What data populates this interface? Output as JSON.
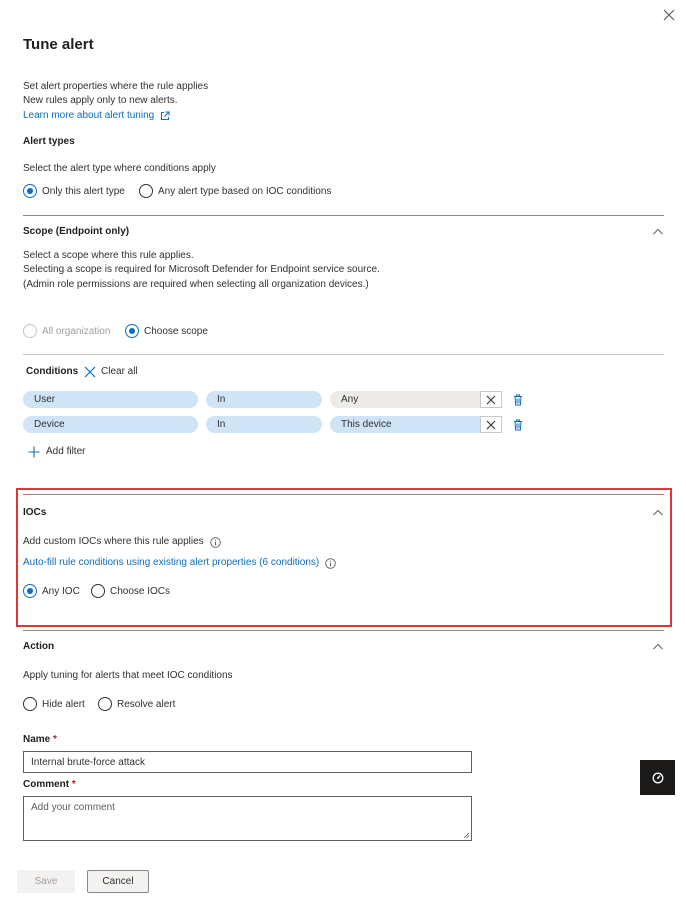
{
  "panel": {
    "title": "Tune alert",
    "intro_line1": "Set alert properties where the rule applies",
    "intro_line2": "New rules apply only to new alerts.",
    "learn_more": "Learn more about alert tuning"
  },
  "alert_types": {
    "heading": "Alert types",
    "description": "Select the alert type where conditions apply",
    "options": [
      "Only this alert type",
      "Any alert type based on IOC conditions"
    ],
    "selected": 0
  },
  "scope": {
    "heading": "Scope (Endpoint only)",
    "line1": "Select a scope where this rule applies.",
    "line2": "Selecting a scope is required for Microsoft Defender for Endpoint service source.",
    "line3": "(Admin role permissions are required when selecting all organization devices.)",
    "options": [
      "All organization",
      "Choose scope"
    ],
    "selected": 1
  },
  "conditions": {
    "label": "Conditions",
    "clear_all": "Clear all",
    "rows": [
      {
        "field": "User",
        "operator": "In",
        "value": "Any"
      },
      {
        "field": "Device",
        "operator": "In",
        "value": "This device"
      }
    ],
    "add_filter": "Add filter"
  },
  "iocs": {
    "heading": "IOCs",
    "description": "Add custom IOCs where this rule applies",
    "autofill_link": "Auto-fill rule conditions using existing alert properties (6 conditions)",
    "options": [
      "Any IOC",
      "Choose IOCs"
    ],
    "selected": 0
  },
  "action": {
    "heading": "Action",
    "description": "Apply tuning for alerts that meet IOC conditions",
    "options": [
      "Hide alert",
      "Resolve alert"
    ],
    "selected": null
  },
  "form": {
    "name_label": "Name",
    "name_value": "Internal brute-force attack",
    "comment_label": "Comment",
    "comment_placeholder": "Add your comment",
    "required_mark": "*"
  },
  "buttons": {
    "save": "Save",
    "cancel": "Cancel"
  },
  "colors": {
    "accent": "#0f6cbd",
    "highlight_border": "#e0343a",
    "pill": "#cfe4f7"
  }
}
